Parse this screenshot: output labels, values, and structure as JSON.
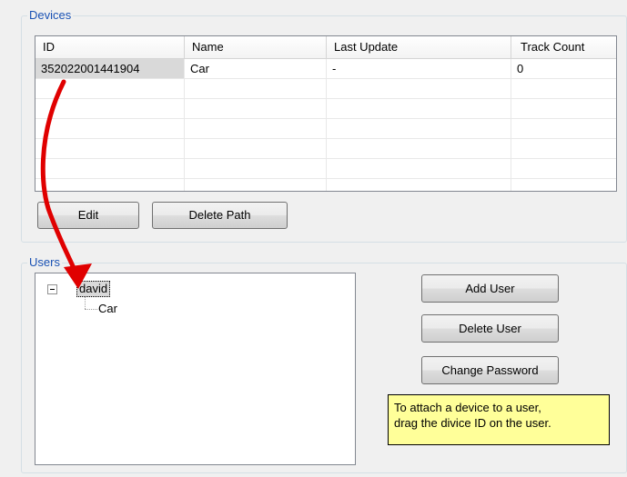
{
  "devices": {
    "group_title": "Devices",
    "columns": [
      "ID",
      "Name",
      "Last Update",
      "Track Count"
    ],
    "rows": [
      {
        "id": "352022001441904",
        "name": "Car",
        "last_update": "-",
        "track_count": "0"
      }
    ],
    "edit_label": "Edit",
    "delete_path_label": "Delete Path"
  },
  "users": {
    "group_title": "Users",
    "tree": [
      {
        "label": "david",
        "children": [
          "Car"
        ]
      }
    ],
    "add_user_label": "Add User",
    "delete_user_label": "Delete User",
    "change_password_label": "Change Password",
    "hint_line1": "To attach a device to a user,",
    "hint_line2": "drag the divice ID on the user."
  },
  "colors": {
    "group_title": "#1a52b4",
    "hint_background": "#ffff99",
    "drag_arrow": "#e00000"
  },
  "icons": {
    "tree_toggle": "minus-box-icon",
    "drag_arrow": "red-arrow-icon"
  }
}
